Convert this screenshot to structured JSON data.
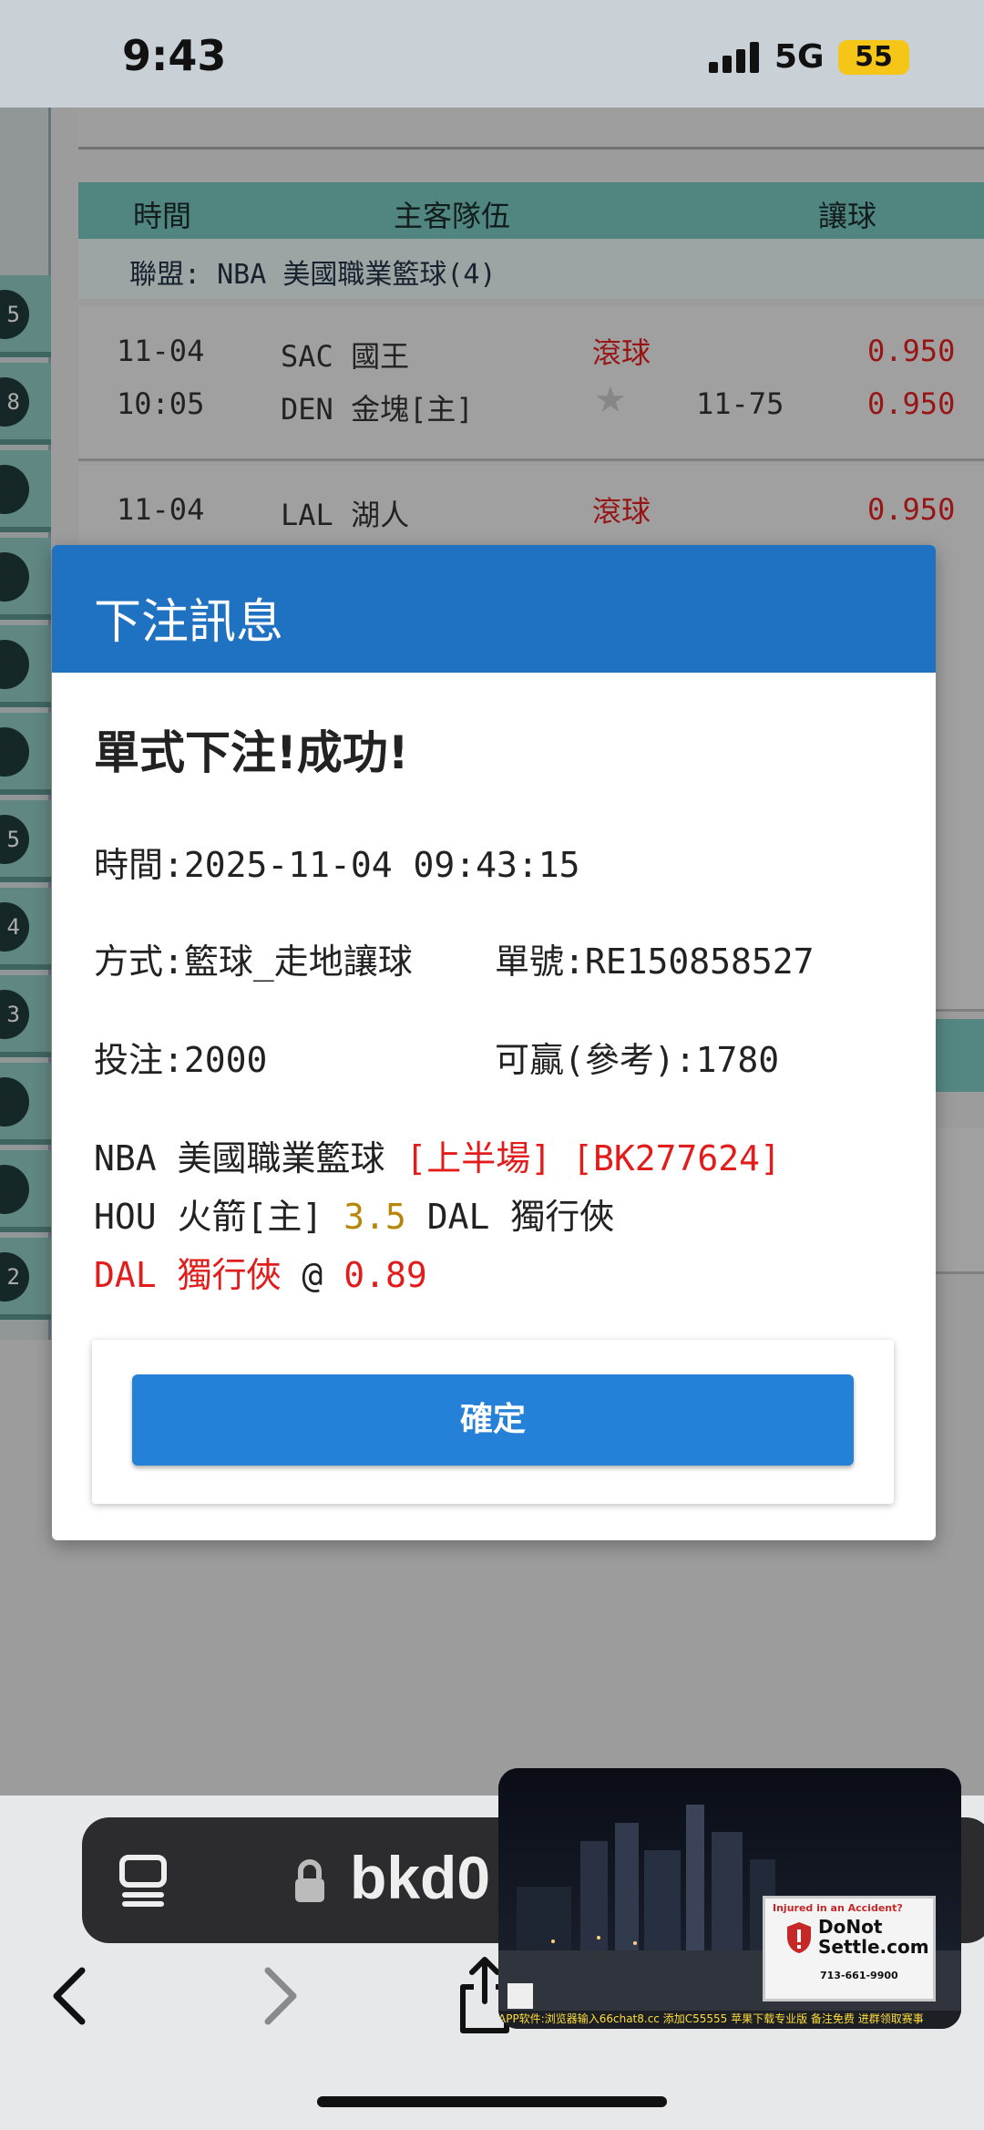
{
  "status_bar": {
    "time": "9:43",
    "network": "5G",
    "battery": "55"
  },
  "background_table": {
    "headers": [
      "時間",
      "主客隊伍",
      "讓球"
    ],
    "league": "聯盟: NBA 美國職業籃球(4)",
    "games": [
      {
        "date": "11-04",
        "time": "10:05",
        "home_team": "SAC 國王",
        "away_team": "DEN 金塊[主]",
        "status": "滾球",
        "line": "11-75",
        "odds_top": "0.950",
        "odds_bottom": "0.950"
      },
      {
        "date": "11-04",
        "home_team": "LAL 湖人",
        "status": "滾球",
        "odds_top": "0.950"
      }
    ],
    "left_badges": [
      "5",
      "8",
      "",
      "",
      "",
      "",
      "5",
      "4",
      "3",
      "",
      "",
      "2"
    ]
  },
  "modal": {
    "title": "下注訊息",
    "success": "單式下注!成功!",
    "time_line": "時間:2025-11-04 09:43:15",
    "method_line": "方式:籃球_走地讓球",
    "order_line": "單號:RE150858527",
    "stake_line": "投注:2000",
    "win_line": "可贏(參考):1780",
    "detail": {
      "league": "NBA 美國職業籃球",
      "half": "[上半場]",
      "code": "[BK277624]",
      "home": "HOU 火箭[主]",
      "handicap": "3.5",
      "away": "DAL 獨行俠",
      "pick": "DAL 獨行俠",
      "at": "@",
      "odds": "0.89"
    },
    "confirm_label": "確定"
  },
  "browser": {
    "url": "bkd0"
  },
  "video_ad": {
    "headline": "Injured in an Accident?",
    "brand": "DoNot Settle.com",
    "phone": "713-661-9900",
    "ticker": "APP软件:浏览器输入66chat8.cc 添加C55555 苹果下载专业版 备注免费 进群领取赛事"
  },
  "colors": {
    "header_blue": "#1f72c2",
    "button_blue": "#2481d7",
    "accent_red": "#e21b1b",
    "handicap_gold": "#b8860b"
  }
}
